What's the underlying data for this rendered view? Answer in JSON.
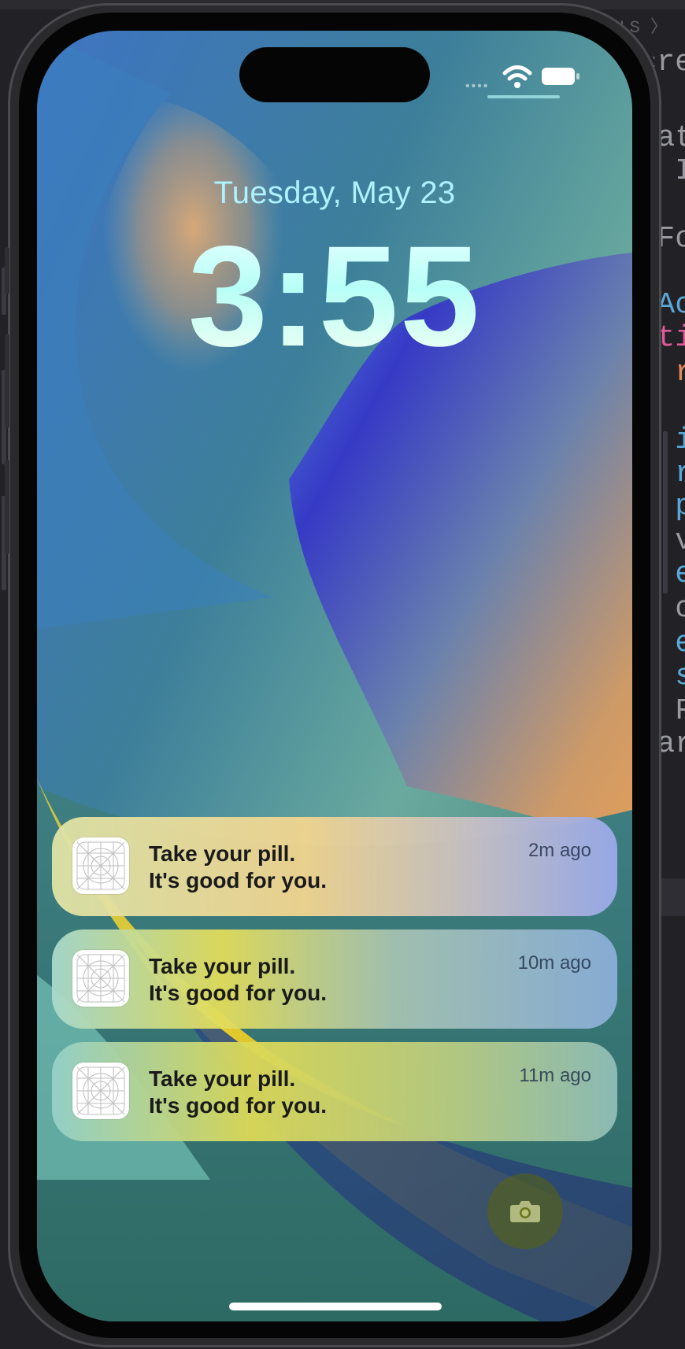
{
  "editor": {
    "breadcrumb": "DELS 〉",
    "code_lines": [
      {
        "text": "cre",
        "color": "#9a9aa2"
      },
      {
        "text": "at",
        "color": "#9a9aa2"
      },
      {
        "text": "I",
        "color": "#9a9aa2"
      },
      {
        "text": "Fo",
        "color": "#9a9aa2"
      },
      {
        "text": "Ac",
        "color": "#5aa8d8"
      },
      {
        "text": "ti",
        "color": "#e05a9a"
      },
      {
        "text": "r",
        "color": "#e08a5a"
      },
      {
        "text": "i",
        "color": "#5aa8d8"
      },
      {
        "text": "r",
        "color": "#5aa8d8"
      },
      {
        "text": "p",
        "color": "#5aa8d8"
      },
      {
        "text": "v",
        "color": "#9a9aa2"
      },
      {
        "text": "e",
        "color": "#5aa8d8"
      },
      {
        "text": "c",
        "color": "#9a9aa2"
      },
      {
        "text": "e",
        "color": "#5aa8d8"
      },
      {
        "text": "s",
        "color": "#5aa8d8"
      },
      {
        "text": "F",
        "color": "#9a9aa2"
      },
      {
        "text": "ar",
        "color": "#9a9aa2"
      }
    ]
  },
  "status_bar": {
    "signal_dots": "••••",
    "wifi_icon": "wifi-icon",
    "battery_icon": "battery-icon"
  },
  "lock_screen": {
    "date": "Tuesday, May 23",
    "time": "3:55"
  },
  "notifications": [
    {
      "title": "Take your pill.",
      "body": "It's good for you.",
      "time": "2m ago"
    },
    {
      "title": "Take your pill.",
      "body": "It's good for you.",
      "time": "10m ago"
    },
    {
      "title": "Take your pill.",
      "body": "It's good for you.",
      "time": "11m ago"
    }
  ],
  "quick_actions": {
    "camera_icon": "camera-icon"
  },
  "colors": {
    "date_text": "#aef2ff",
    "notification_text": "#1a1a1a",
    "device_frame": "#050505"
  }
}
